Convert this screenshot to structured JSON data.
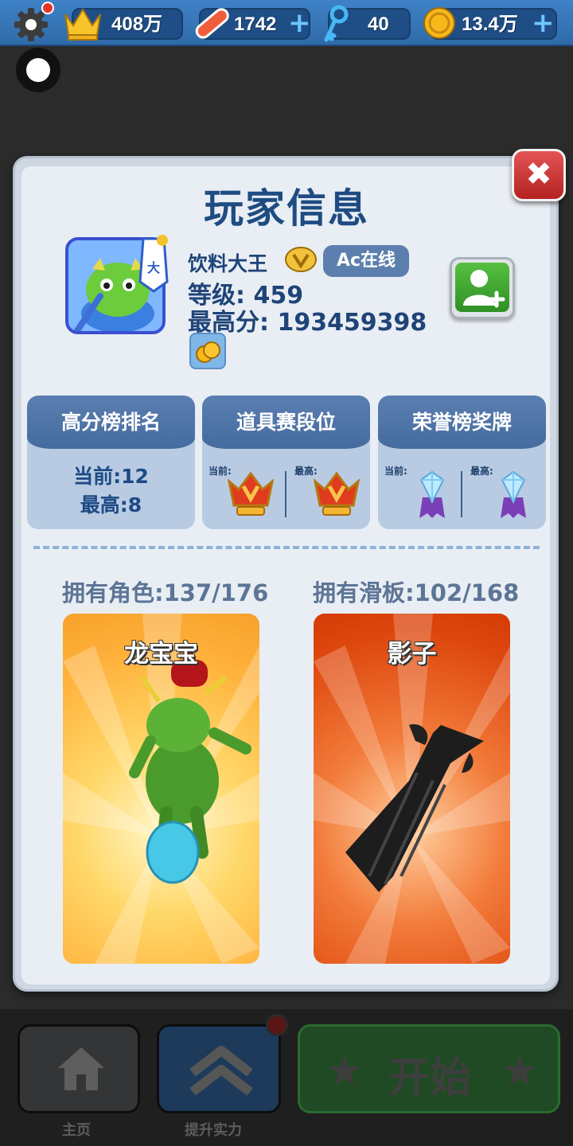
{
  "topbar": {
    "trophies": "408万",
    "boards": "1742",
    "keys": "40",
    "coins": "13.4万"
  },
  "panel": {
    "title": "玩家信息",
    "player": {
      "name": "饮料大王",
      "online_status": "Ac在线",
      "level": "等级: 459",
      "best_score": "最高分: 193459398"
    },
    "cards": [
      {
        "title": "高分榜排名",
        "current": "当前:12",
        "best": "最高:8"
      },
      {
        "title": "道具赛段位",
        "current_label": "当前:",
        "best_label": "最高:"
      },
      {
        "title": "荣誉榜奖牌",
        "current_label": "当前:",
        "best_label": "最高:"
      }
    ],
    "owned_characters": "拥有角色:137/176",
    "owned_boards": "拥有滑板:102/168",
    "character_name": "龙宝宝",
    "board_name": "影子"
  },
  "bottom_nav": {
    "home": "主页",
    "upgrade": "提升实力",
    "start": "开始"
  }
}
